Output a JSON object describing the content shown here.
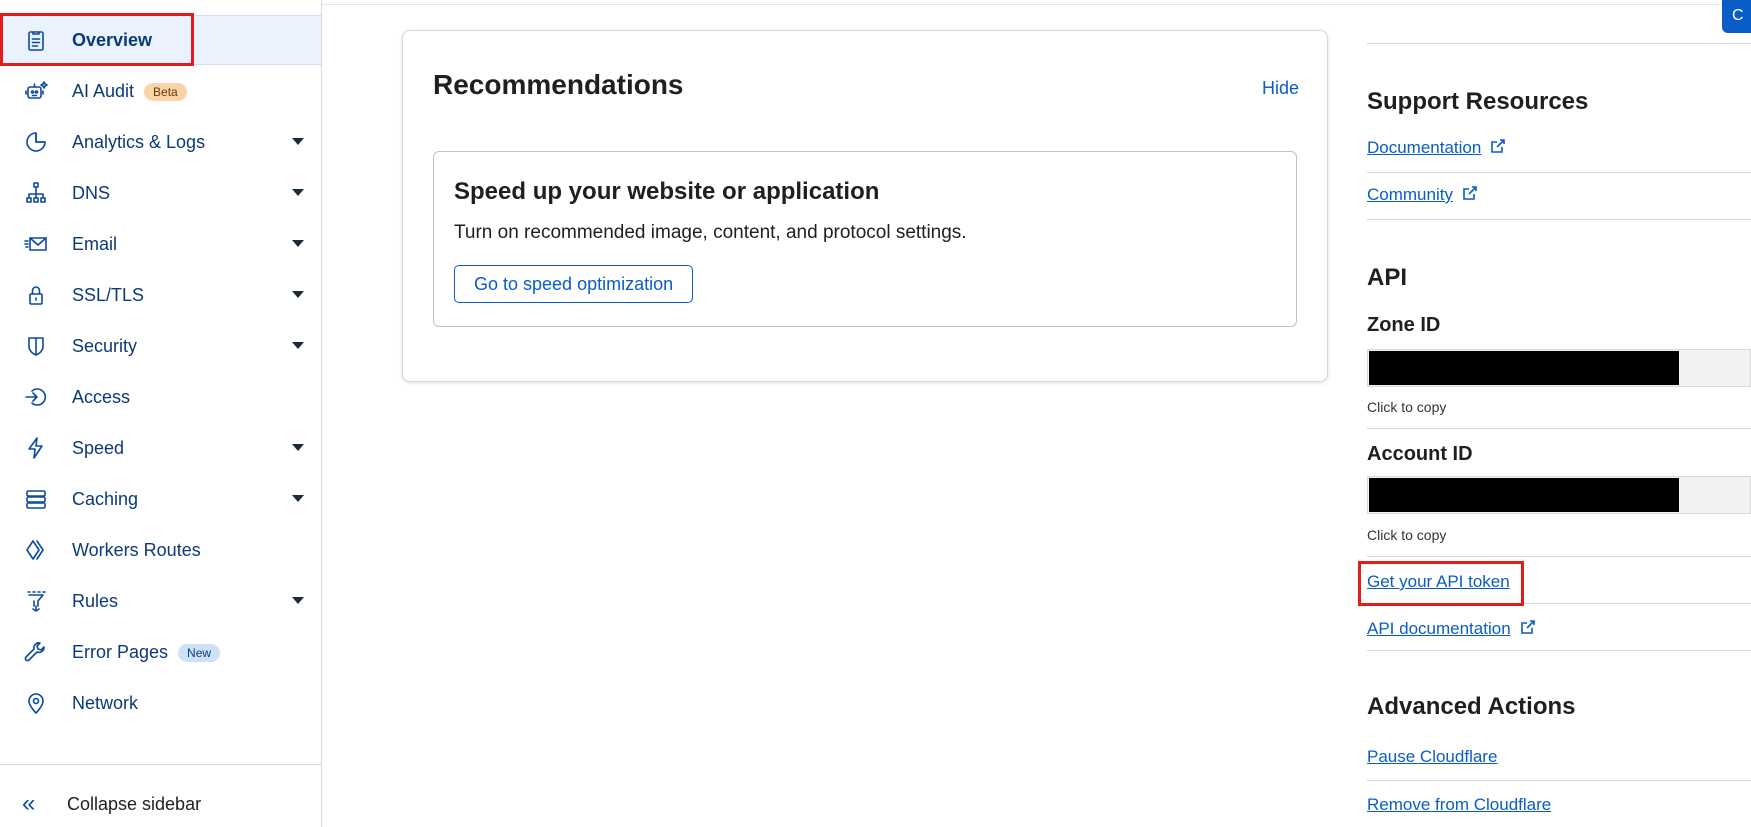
{
  "sidebar": {
    "items": [
      {
        "label": "Overview",
        "icon": "document-icon",
        "active": true
      },
      {
        "label": "AI Audit",
        "icon": "robot-icon",
        "badge": "Beta"
      },
      {
        "label": "Analytics & Logs",
        "icon": "pie-chart-icon",
        "expandable": true
      },
      {
        "label": "DNS",
        "icon": "network-tree-icon",
        "expandable": true
      },
      {
        "label": "Email",
        "icon": "envelope-icon",
        "expandable": true
      },
      {
        "label": "SSL/TLS",
        "icon": "lock-icon",
        "expandable": true
      },
      {
        "label": "Security",
        "icon": "shield-icon",
        "expandable": true
      },
      {
        "label": "Access",
        "icon": "sign-in-icon"
      },
      {
        "label": "Speed",
        "icon": "lightning-icon",
        "expandable": true
      },
      {
        "label": "Caching",
        "icon": "server-stack-icon",
        "expandable": true
      },
      {
        "label": "Workers Routes",
        "icon": "workers-icon"
      },
      {
        "label": "Rules",
        "icon": "funnel-icon",
        "expandable": true
      },
      {
        "label": "Error Pages",
        "icon": "wrench-icon",
        "badge": "New"
      },
      {
        "label": "Network",
        "icon": "location-pin-icon"
      }
    ],
    "collapse_label": "Collapse sidebar"
  },
  "recommendations": {
    "title": "Recommendations",
    "hide_label": "Hide",
    "card": {
      "title": "Speed up your website or application",
      "description": "Turn on recommended image, content, and protocol settings.",
      "button_label": "Go to speed optimization"
    }
  },
  "right_panel": {
    "corner_button_label": "C",
    "support": {
      "title": "Support Resources",
      "links": [
        "Documentation",
        "Community"
      ]
    },
    "api": {
      "title": "API",
      "zone_id_label": "Zone ID",
      "zone_copy_hint": "Click to copy",
      "account_id_label": "Account ID",
      "account_copy_hint": "Click to copy",
      "token_link": "Get your API token",
      "docs_link": "API documentation"
    },
    "advanced": {
      "title": "Advanced Actions",
      "links": [
        "Pause Cloudflare",
        "Remove from Cloudflare"
      ]
    }
  },
  "colors": {
    "accent": "#0a5cc7",
    "nav_text": "#0c3a78",
    "highlight_box": "#e21b1b"
  }
}
